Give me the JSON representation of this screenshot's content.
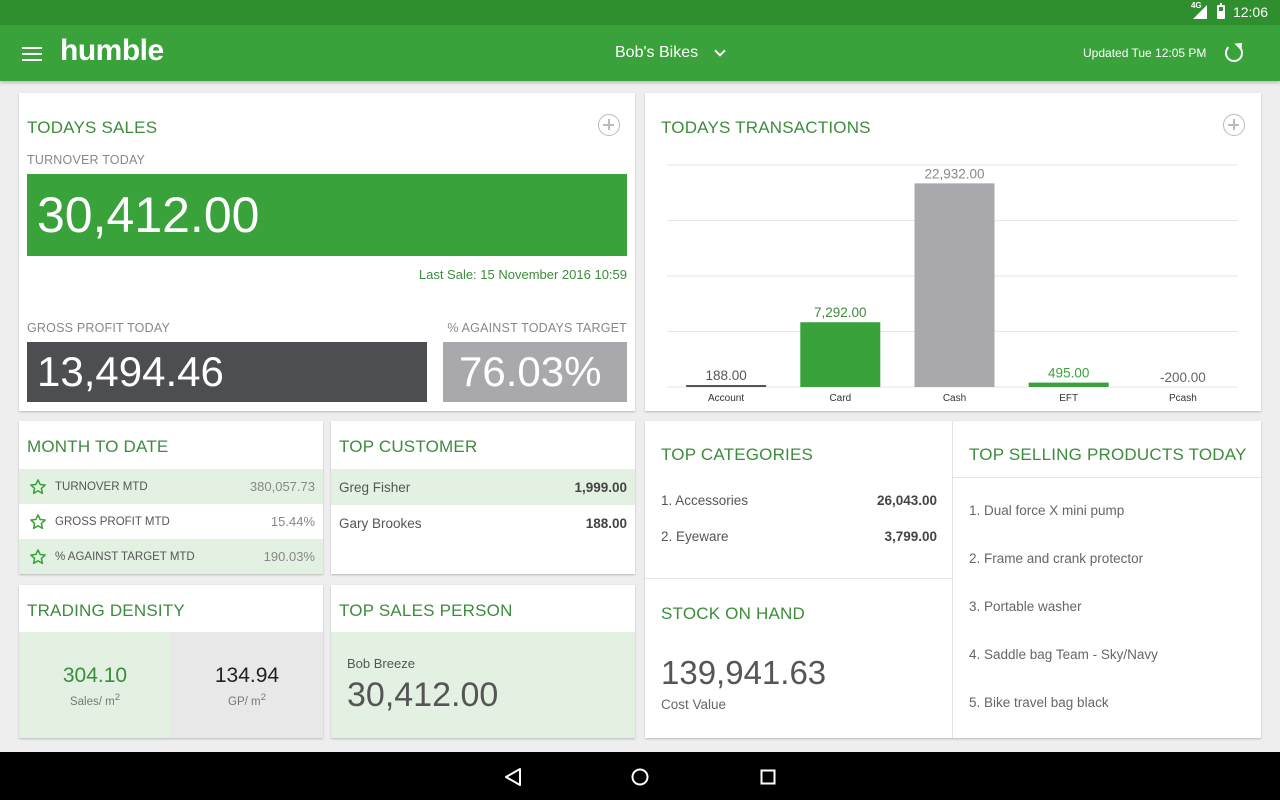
{
  "status": {
    "network": "4G",
    "time": "12:06"
  },
  "appbar": {
    "logo": "humble",
    "store": "Bob's Bikes",
    "updated": "Updated Tue 12:05 PM"
  },
  "todays_sales": {
    "title": "TODAYS SALES",
    "turnover_label": "TURNOVER TODAY",
    "turnover": "30,412.00",
    "last_sale": "Last Sale: 15 November 2016 10:59",
    "gp_label": "GROSS PROFIT TODAY",
    "gp": "13,494.46",
    "target_label": "% AGAINST TODAYS TARGET",
    "target": "76.03%"
  },
  "transactions": {
    "title": "TODAYS TRANSACTIONS"
  },
  "chart_data": {
    "type": "bar",
    "categories": [
      "Account",
      "Card",
      "Cash",
      "EFT",
      "Pcash"
    ],
    "values": [
      188.0,
      7292.0,
      22932.0,
      495.0,
      -200.0
    ],
    "labels": [
      "188.00",
      "7,292.00",
      "22,932.00",
      "495.00",
      "-200.00"
    ],
    "colors": [
      "#555555",
      "#3aa23a",
      "#a9a9ad",
      "#3aa23a",
      "#999999"
    ],
    "label_colors": [
      "#555555",
      "#3d8c3d",
      "#888888",
      "#3aa23a",
      "#666666"
    ],
    "ylim": [
      0,
      25000
    ],
    "grid": true
  },
  "mtd": {
    "title": "MONTH TO DATE",
    "rows": [
      {
        "label": "TURNOVER MTD",
        "value": "380,057.73"
      },
      {
        "label": "GROSS PROFIT MTD",
        "value": "15.44%"
      },
      {
        "label": "% AGAINST TARGET MTD",
        "value": "190.03%"
      }
    ]
  },
  "top_customer": {
    "title": "TOP CUSTOMER",
    "rows": [
      {
        "name": "Greg Fisher",
        "value": "1,999.00"
      },
      {
        "name": "Gary Brookes",
        "value": "188.00"
      }
    ]
  },
  "top_categories": {
    "title": "TOP CATEGORIES",
    "rows": [
      {
        "name": "1. Accessories",
        "value": "26,043.00"
      },
      {
        "name": "2. Eyeware",
        "value": "3,799.00"
      }
    ]
  },
  "top_products": {
    "title": "TOP SELLING PRODUCTS TODAY",
    "items": [
      "1. Dual force  X mini pump",
      "2. Frame and crank protector",
      "3. Portable washer",
      "4. Saddle bag Team - Sky/Navy",
      "5. Bike travel bag black"
    ]
  },
  "trading_density": {
    "title": "TRADING DENSITY",
    "sales_value": "304.10",
    "sales_label": "Sales/ m",
    "gp_value": "134.94",
    "gp_label": "GP/ m",
    "sup": "2"
  },
  "top_sales_person": {
    "title": "TOP SALES PERSON",
    "name": "Bob  Breeze",
    "value": "30,412.00"
  },
  "stock": {
    "title": "STOCK ON HAND",
    "value": "139,941.63",
    "label": "Cost Value"
  },
  "colors": {
    "brand": "#3aa23a",
    "brand_dark": "#2f8f2f",
    "title_green": "#3d8c3d",
    "dark_box": "#4d4e52",
    "grey_box": "#a9a9ad"
  }
}
